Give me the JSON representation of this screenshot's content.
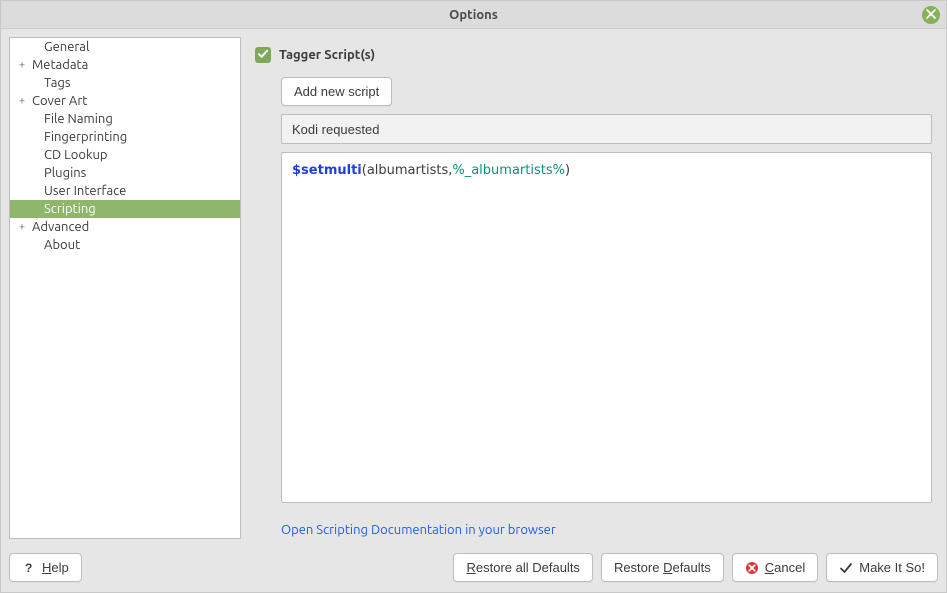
{
  "window": {
    "title": "Options"
  },
  "sidebar": {
    "items": [
      {
        "label": "General",
        "expandable": false,
        "indent": 1,
        "selected": false
      },
      {
        "label": "Metadata",
        "expandable": true,
        "indent": 0,
        "selected": false
      },
      {
        "label": "Tags",
        "expandable": false,
        "indent": 1,
        "selected": false
      },
      {
        "label": "Cover Art",
        "expandable": true,
        "indent": 0,
        "selected": false
      },
      {
        "label": "File Naming",
        "expandable": false,
        "indent": 1,
        "selected": false
      },
      {
        "label": "Fingerprinting",
        "expandable": false,
        "indent": 1,
        "selected": false
      },
      {
        "label": "CD Lookup",
        "expandable": false,
        "indent": 1,
        "selected": false
      },
      {
        "label": "Plugins",
        "expandable": false,
        "indent": 1,
        "selected": false
      },
      {
        "label": "User Interface",
        "expandable": false,
        "indent": 1,
        "selected": false
      },
      {
        "label": "Scripting",
        "expandable": false,
        "indent": 1,
        "selected": true
      },
      {
        "label": "Advanced",
        "expandable": true,
        "indent": 0,
        "selected": false
      },
      {
        "label": "About",
        "expandable": false,
        "indent": 1,
        "selected": false
      }
    ]
  },
  "main": {
    "tagger_checkbox_label": "Tagger Script(s)",
    "tagger_checked": true,
    "add_script_label": "Add new script",
    "script_name": "Kodi requested",
    "editor_tokens": [
      {
        "t": "func",
        "v": "$setmulti"
      },
      {
        "t": "plain",
        "v": "(albumartists,"
      },
      {
        "t": "var",
        "v": "%_albumartists%"
      },
      {
        "t": "plain",
        "v": ")"
      }
    ],
    "doc_link_label": "Open Scripting Documentation in your browser"
  },
  "footer": {
    "help": "Help",
    "restore_all": "Restore all Defaults",
    "restore": "Restore Defaults",
    "cancel": "Cancel",
    "make_it_so": "Make It So!",
    "accel": {
      "help": "H",
      "restore_all": "R",
      "restore": "D",
      "cancel": "C"
    }
  },
  "icons": {
    "expander_plus": "+",
    "question": "?",
    "check": "✓"
  },
  "colors": {
    "accent_green": "#8fb66a",
    "link_blue": "#225ee2",
    "token_func": "#2040d8",
    "token_var": "#0e8f7f",
    "error_red": "#d33"
  }
}
